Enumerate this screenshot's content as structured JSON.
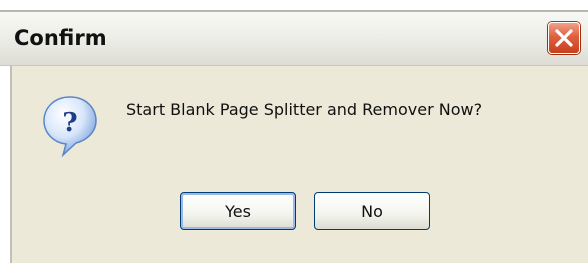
{
  "dialog": {
    "title": "Confirm",
    "message": "Start Blank Page Splitter and Remover Now?",
    "yes_label": "Yes",
    "no_label": "No",
    "icon": "question-icon",
    "close_icon": "close-icon"
  },
  "colors": {
    "dialog_background": "#ece9d8",
    "close_button": "#e0603e",
    "question_icon": "#2a5fb8",
    "button_border": "#003c74"
  }
}
